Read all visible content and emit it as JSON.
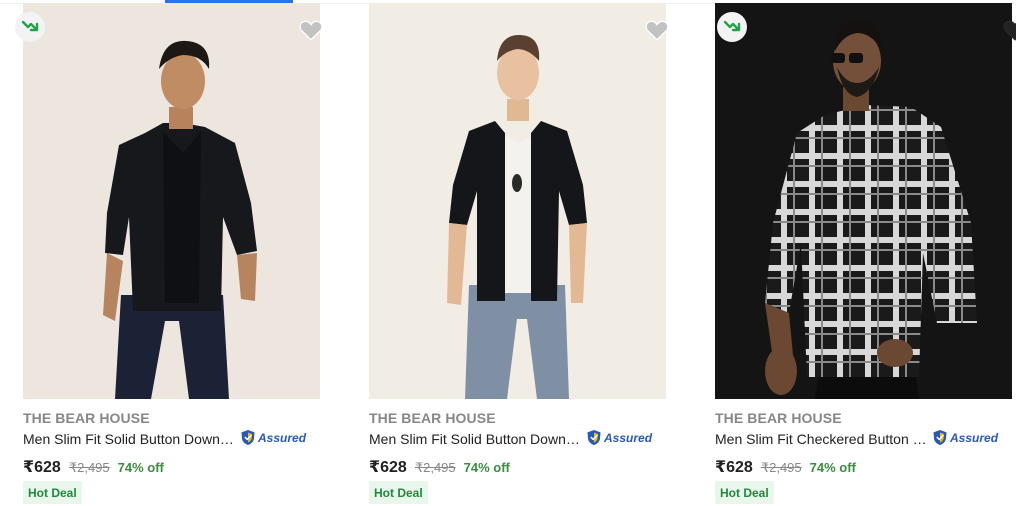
{
  "colors": {
    "accent": "#2874f0",
    "price_green": "#388e3c",
    "assured_blue": "#2858b8",
    "tag_bg": "#e9f6ec"
  },
  "products": [
    {
      "brand": "THE BEAR HOUSE",
      "title": "Men Slim Fit Solid Button Down Collar Casual Shirt",
      "assured_label": "Assured",
      "price": "₹628",
      "mrp": "₹2,495",
      "discount": "74% off",
      "tag": "Hot Deal",
      "has_trend_icon": true,
      "wishlist_icon": "heart-icon"
    },
    {
      "brand": "THE BEAR HOUSE",
      "title": "Men Slim Fit Solid Button Down Collar Casual Shirt",
      "assured_label": "Assured",
      "price": "₹628",
      "mrp": "₹2,495",
      "discount": "74% off",
      "tag": "Hot Deal",
      "has_trend_icon": false,
      "wishlist_icon": "heart-icon"
    },
    {
      "brand": "THE BEAR HOUSE",
      "title": "Men Slim Fit Checkered Button Down Collar Casual Shirt",
      "assured_label": "Assured",
      "price": "₹628",
      "mrp": "₹2,495",
      "discount": "74% off",
      "tag": "Hot Deal",
      "has_trend_icon": true,
      "wishlist_icon": "heart-icon"
    }
  ]
}
